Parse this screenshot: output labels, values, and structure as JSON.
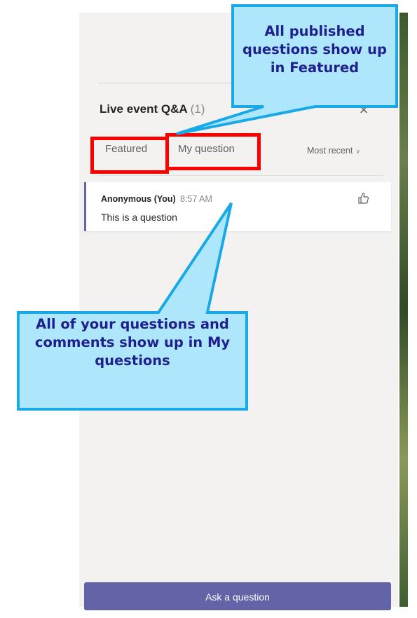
{
  "panel": {
    "title": "Live event Q&A",
    "title_count": "(1)",
    "close_glyph": "×"
  },
  "tabs": [
    {
      "label": "Featured",
      "active": true
    },
    {
      "label": "My question",
      "active": false
    }
  ],
  "sort": {
    "label": "Most recent",
    "chevron": "∨"
  },
  "questions": [
    {
      "author": "Anonymous (You)",
      "time": "8:57 AM",
      "text": "This is a question",
      "like_icon": "thumbs-up-icon"
    }
  ],
  "ask_button": {
    "label": "Ask a question"
  },
  "annotations": {
    "top_callout": "All published questions show up in Featured",
    "bottom_callout": "All of your questions and comments show up in My questions",
    "highlight_color": "#ff0000",
    "callout_fill": "#aee7fb",
    "callout_border": "#18a9e6",
    "callout_text_color": "#1f1f8f"
  },
  "colors": {
    "accent": "#6264a7",
    "panel_bg": "#f3f2f1"
  }
}
